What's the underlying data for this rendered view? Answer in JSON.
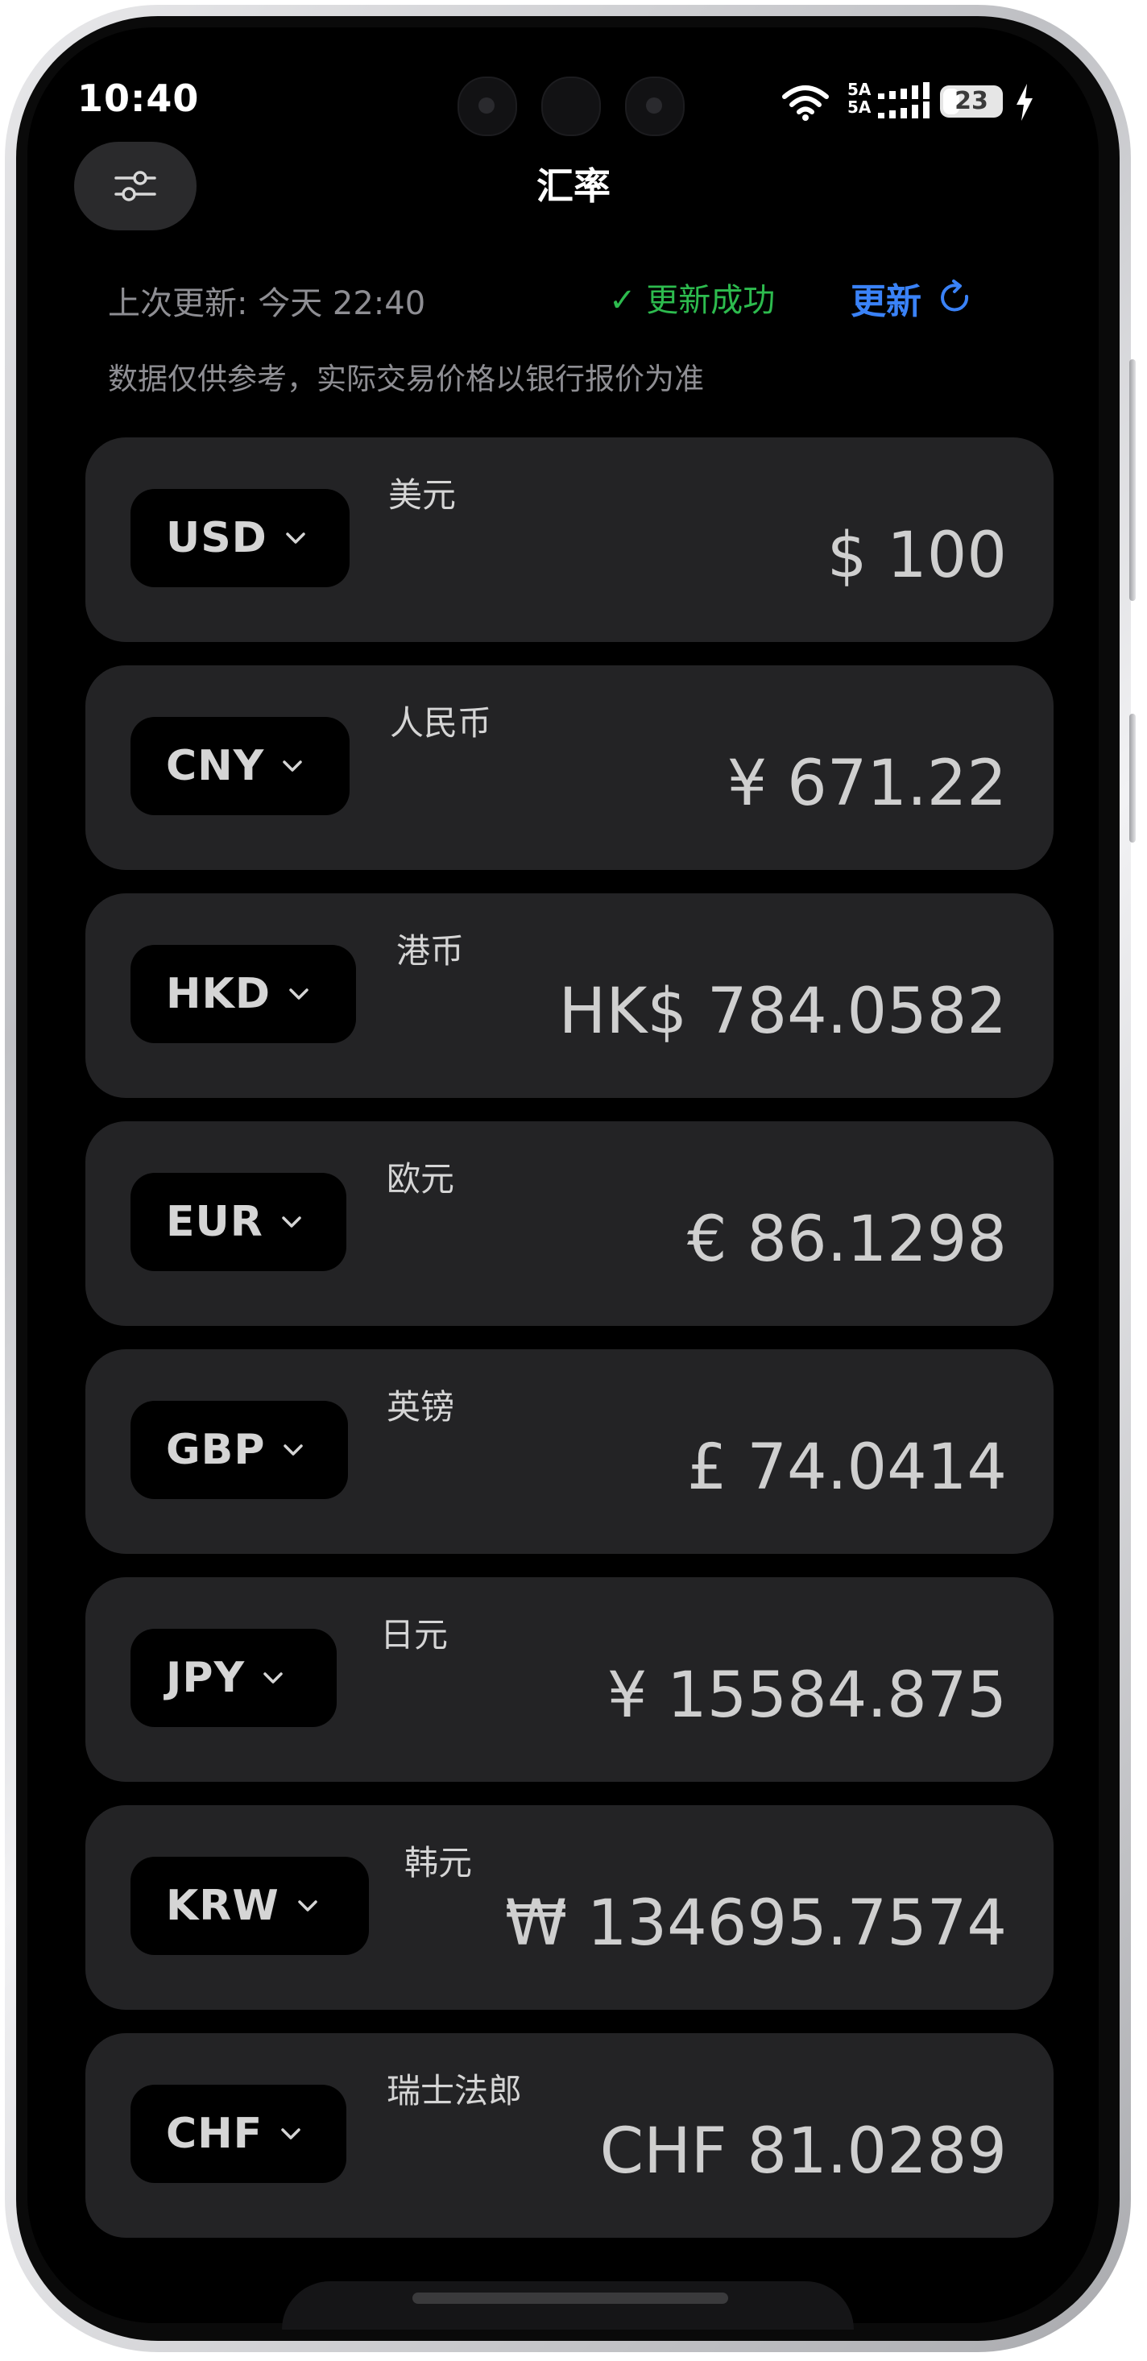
{
  "status_bar": {
    "time": "10:40",
    "network_label_1": "5A",
    "network_label_2": "5A",
    "battery_level": "23",
    "charging": true
  },
  "header": {
    "title": "汇率",
    "settings_icon": "sliders-icon"
  },
  "update_info": {
    "last_update": "上次更新: 今天 22:40",
    "status": "✓ 更新成功",
    "status_color": "#2dbb4e",
    "refresh_label": "更新",
    "refresh_icon": "refresh-icon",
    "accent_color": "#3a82f7"
  },
  "disclaimer": "数据仅供参考，实际交易价格以银行报价为准",
  "currencies": [
    {
      "code": "USD",
      "name": "美元",
      "value": "$ 100"
    },
    {
      "code": "CNY",
      "name": "人民币",
      "value": "¥ 671.22"
    },
    {
      "code": "HKD",
      "name": "港币",
      "value": "HK$ 784.0582"
    },
    {
      "code": "EUR",
      "name": "欧元",
      "value": "€ 86.1298"
    },
    {
      "code": "GBP",
      "name": "英镑",
      "value": "£ 74.0414"
    },
    {
      "code": "JPY",
      "name": "日元",
      "value": "¥ 15584.875"
    },
    {
      "code": "KRW",
      "name": "韩元",
      "value": "₩ 134695.7574"
    },
    {
      "code": "CHF",
      "name": "瑞士法郎",
      "value": "CHF 81.0289"
    }
  ]
}
